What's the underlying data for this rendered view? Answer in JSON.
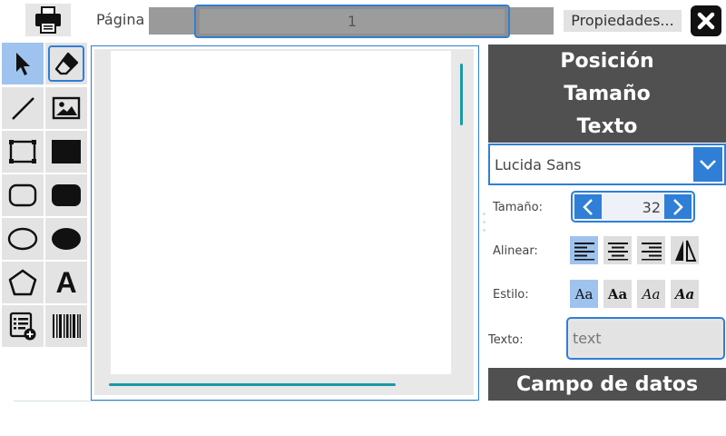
{
  "toolbar": {
    "page_label": "Página",
    "page_value": "1",
    "properties_label": "Propiedades...",
    "icons": {
      "print": "printer-icon",
      "close": "close-icon"
    }
  },
  "tools": [
    {
      "name": "select-arrow-icon",
      "selected": true
    },
    {
      "name": "eraser-icon",
      "selected": false,
      "framed": true
    },
    {
      "name": "line-icon"
    },
    {
      "name": "image-icon"
    },
    {
      "name": "rectangle-outline-icon"
    },
    {
      "name": "rectangle-filled-icon"
    },
    {
      "name": "rounded-rect-outline-icon"
    },
    {
      "name": "rounded-rect-filled-icon"
    },
    {
      "name": "ellipse-outline-icon"
    },
    {
      "name": "ellipse-filled-icon"
    },
    {
      "name": "polygon-icon"
    },
    {
      "name": "text-tool-icon",
      "glyph": "A"
    },
    {
      "name": "add-data-field-icon"
    },
    {
      "name": "barcode-icon"
    }
  ],
  "panel": {
    "sections": [
      "Posición",
      "Tamaño",
      "Texto"
    ],
    "font_name": "Lucida Sans",
    "size_label": "Tamaño:",
    "size_value": "32",
    "align_label": "Alinear:",
    "style_label": "Estilo:",
    "style_buttons": [
      "Aa",
      "Aa",
      "Aa",
      "Aa"
    ],
    "text_label": "Texto:",
    "text_placeholder": "text",
    "data_field_section": "Campo de datos"
  },
  "colors": {
    "accent": "#2f7fd6",
    "selected": "#9fc3ef",
    "section_bg": "#505050",
    "scrollbar": "#1a9aa8"
  }
}
